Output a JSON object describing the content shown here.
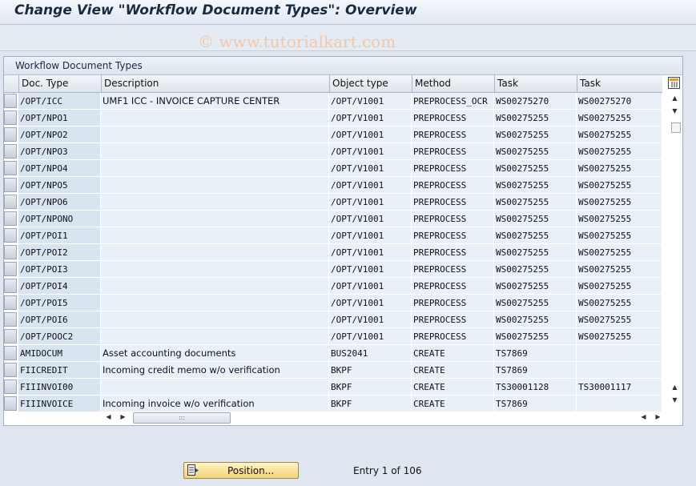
{
  "title": "Change View \"Workflow Document Types\": Overview",
  "watermark": "© www.tutorialkart.com",
  "panel_title": "Workflow Document Types",
  "columns": [
    "Doc. Type",
    "Description",
    "Object type",
    "Method",
    "Task",
    "Task"
  ],
  "rows": [
    {
      "doc_type": "/OPT/ICC",
      "description": "UMF1 ICC - INVOICE CAPTURE CENTER",
      "object_type": "/OPT/V1001",
      "method": "PREPROCESS_OCR",
      "task1": "WS00275270",
      "task2": "WS00275270"
    },
    {
      "doc_type": "/OPT/NPO1",
      "description": "",
      "object_type": "/OPT/V1001",
      "method": "PREPROCESS",
      "task1": "WS00275255",
      "task2": "WS00275255"
    },
    {
      "doc_type": "/OPT/NPO2",
      "description": "",
      "object_type": "/OPT/V1001",
      "method": "PREPROCESS",
      "task1": "WS00275255",
      "task2": "WS00275255"
    },
    {
      "doc_type": "/OPT/NPO3",
      "description": "",
      "object_type": "/OPT/V1001",
      "method": "PREPROCESS",
      "task1": "WS00275255",
      "task2": "WS00275255"
    },
    {
      "doc_type": "/OPT/NPO4",
      "description": "",
      "object_type": "/OPT/V1001",
      "method": "PREPROCESS",
      "task1": "WS00275255",
      "task2": "WS00275255"
    },
    {
      "doc_type": "/OPT/NPO5",
      "description": "",
      "object_type": "/OPT/V1001",
      "method": "PREPROCESS",
      "task1": "WS00275255",
      "task2": "WS00275255"
    },
    {
      "doc_type": "/OPT/NPO6",
      "description": "",
      "object_type": "/OPT/V1001",
      "method": "PREPROCESS",
      "task1": "WS00275255",
      "task2": "WS00275255"
    },
    {
      "doc_type": "/OPT/NPONO",
      "description": "",
      "object_type": "/OPT/V1001",
      "method": "PREPROCESS",
      "task1": "WS00275255",
      "task2": "WS00275255"
    },
    {
      "doc_type": "/OPT/POI1",
      "description": "",
      "object_type": "/OPT/V1001",
      "method": "PREPROCESS",
      "task1": "WS00275255",
      "task2": "WS00275255"
    },
    {
      "doc_type": "/OPT/POI2",
      "description": "",
      "object_type": "/OPT/V1001",
      "method": "PREPROCESS",
      "task1": "WS00275255",
      "task2": "WS00275255"
    },
    {
      "doc_type": "/OPT/POI3",
      "description": "",
      "object_type": "/OPT/V1001",
      "method": "PREPROCESS",
      "task1": "WS00275255",
      "task2": "WS00275255"
    },
    {
      "doc_type": "/OPT/POI4",
      "description": "",
      "object_type": "/OPT/V1001",
      "method": "PREPROCESS",
      "task1": "WS00275255",
      "task2": "WS00275255"
    },
    {
      "doc_type": "/OPT/POI5",
      "description": "",
      "object_type": "/OPT/V1001",
      "method": "PREPROCESS",
      "task1": "WS00275255",
      "task2": "WS00275255"
    },
    {
      "doc_type": "/OPT/POI6",
      "description": "",
      "object_type": "/OPT/V1001",
      "method": "PREPROCESS",
      "task1": "WS00275255",
      "task2": "WS00275255"
    },
    {
      "doc_type": "/OPT/POOC2",
      "description": "",
      "object_type": "/OPT/V1001",
      "method": "PREPROCESS",
      "task1": "WS00275255",
      "task2": "WS00275255"
    },
    {
      "doc_type": "AMIDOCUM",
      "description": "Asset accounting documents",
      "object_type": "BUS2041",
      "method": "CREATE",
      "task1": "TS7869",
      "task2": ""
    },
    {
      "doc_type": "FIICREDIT",
      "description": "Incoming credit memo w/o verification",
      "object_type": "BKPF",
      "method": "CREATE",
      "task1": "TS7869",
      "task2": ""
    },
    {
      "doc_type": "FIIINVOI00",
      "description": "",
      "object_type": "BKPF",
      "method": "CREATE",
      "task1": "TS30001128",
      "task2": "TS30001117"
    },
    {
      "doc_type": "FIIINVOICE",
      "description": "Incoming invoice w/o verification",
      "object_type": "BKPF",
      "method": "CREATE",
      "task1": "TS7869",
      "task2": ""
    }
  ],
  "position_button": "Position...",
  "entry_text": "Entry 1 of 106"
}
